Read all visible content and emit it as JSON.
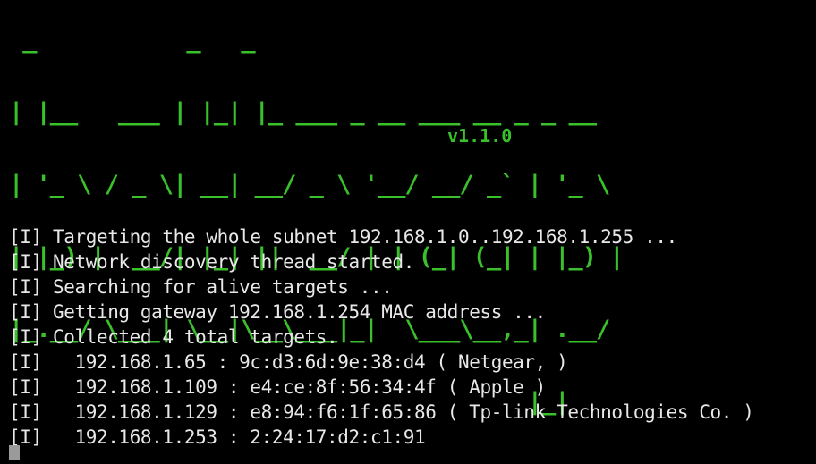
{
  "theme": {
    "background": "#000000",
    "banner_color": "#39c02a",
    "text_color": "#e8e8e8",
    "cursor_color": "#9a9a9a"
  },
  "banner": {
    "lines": [
      " _           _   _",
      "| |__   ___ | |_| |_ ___ _ __ ___ __ _ _ __",
      "| '_ \\ / _ \\| __| __/ _ \\ '__/ __/ _` | '_ \\",
      "| |_) |  __/| |_| ||  __/ | | (_| (_| | |_) |",
      "|_.__/ \\___| \\__|\\__\\___|_|  \\___\\__,_| .__/",
      "                                      |_|"
    ],
    "version": "v1.1.0"
  },
  "log": [
    {
      "tag": "[I]",
      "text": " Targeting the whole subnet 192.168.1.0..192.168.1.255 ..."
    },
    {
      "tag": "[I]",
      "text": " Network discovery thread started."
    },
    {
      "tag": "[I]",
      "text": " Searching for alive targets ..."
    },
    {
      "tag": "[I]",
      "text": " Getting gateway 192.168.1.254 MAC address ..."
    },
    {
      "tag": "[I]",
      "text": " Collected 4 total targets."
    },
    {
      "tag": "[I]",
      "text": "   192.168.1.65 : 9c:d3:6d:9e:38:d4 ( Netgear, )"
    },
    {
      "tag": "[I]",
      "text": "   192.168.1.109 : e4:ce:8f:56:34:4f ( Apple )"
    },
    {
      "tag": "[I]",
      "text": "   192.168.1.129 : e8:94:f6:1f:65:86 ( Tp-link Technologies Co. )"
    },
    {
      "tag": "[I]",
      "text": "   192.168.1.253 : 2:24:17:d2:c1:91"
    }
  ]
}
